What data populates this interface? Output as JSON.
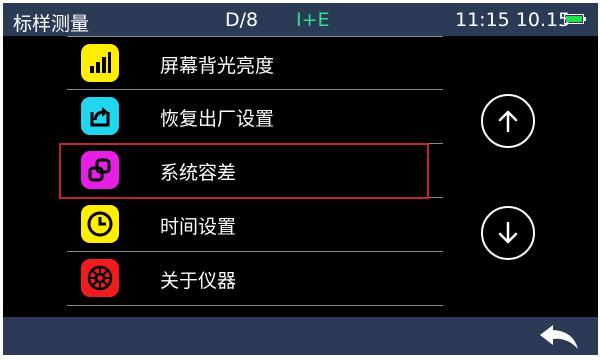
{
  "statusbar": {
    "title": "标样测量",
    "mode": "D/8",
    "mark": "I+E",
    "datetime": "11:15 10.15",
    "battery_level": 1.0,
    "battery_color": "#22e04a"
  },
  "menu": {
    "selected_index": 2,
    "items": [
      {
        "label": "屏幕背光亮度",
        "icon": "signal-bars-icon",
        "icon_color": "#ffee00"
      },
      {
        "label": "恢复出厂设置",
        "icon": "restore-icon",
        "icon_color": "#22d6f0"
      },
      {
        "label": "系统容差",
        "icon": "tolerance-icon",
        "icon_color": "#e61ee6"
      },
      {
        "label": "时间设置",
        "icon": "clock-icon",
        "icon_color": "#ffee00"
      },
      {
        "label": "关于仪器",
        "icon": "info-wheel-icon",
        "icon_color": "#ee1c1c"
      }
    ]
  },
  "navigation": {
    "up_icon": "arrow-up-icon",
    "down_icon": "arrow-down-icon",
    "back_icon": "back-arrow-icon"
  },
  "colors": {
    "bar_background": "#2b3a55",
    "screen_background": "#000000",
    "selection_border": "#c0272d",
    "mark_text": "#2de08c"
  }
}
